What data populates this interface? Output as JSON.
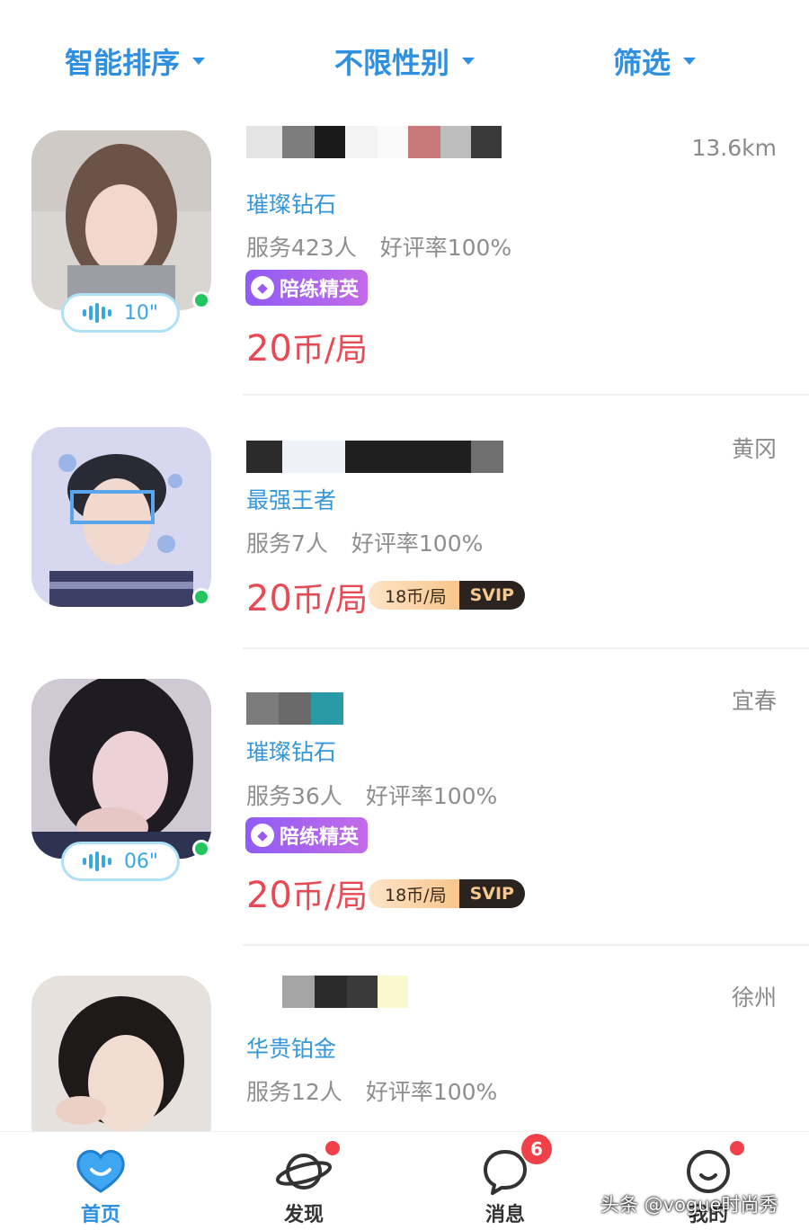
{
  "filters": {
    "sort": "智能排序",
    "gender": "不限性别",
    "screen": "筛选"
  },
  "colors": {
    "accent": "#2f8fe0",
    "price": "#e84a55",
    "online": "#22c55e",
    "badge_purple": "#9a5cf0"
  },
  "cards": [
    {
      "location": "13.6km",
      "tier": "璀璨钻石",
      "served": "服务423人",
      "rating": "好评率100%",
      "badge": "陪练精英",
      "voice": "10\"",
      "price_num": "20",
      "price_unit": "币/局",
      "online": true
    },
    {
      "location": "黄冈",
      "tier": "最强王者",
      "served": "服务7人",
      "rating": "好评率100%",
      "price_num": "20",
      "price_unit": "币/局",
      "svip_price": "18币/局",
      "svip_tag": "SVIP",
      "online": true
    },
    {
      "location": "宜春",
      "tier": "璀璨钻石",
      "served": "服务36人",
      "rating": "好评率100%",
      "badge": "陪练精英",
      "voice": "06\"",
      "price_num": "20",
      "price_unit": "币/局",
      "svip_price": "18币/局",
      "svip_tag": "SVIP",
      "online": true
    },
    {
      "location": "徐州",
      "tier": "华贵铂金",
      "served": "服务12人",
      "rating": "好评率100%"
    }
  ],
  "nav": {
    "home": "首页",
    "discover": "发现",
    "messages": "消息",
    "messages_count": "6",
    "mine": "我的",
    "home_icon": "heart-face-icon",
    "discover_icon": "planet-icon",
    "messages_icon": "chat-bubble-icon",
    "mine_icon": "smile-face-icon"
  },
  "watermark": "头条 @vogue时尚秀"
}
